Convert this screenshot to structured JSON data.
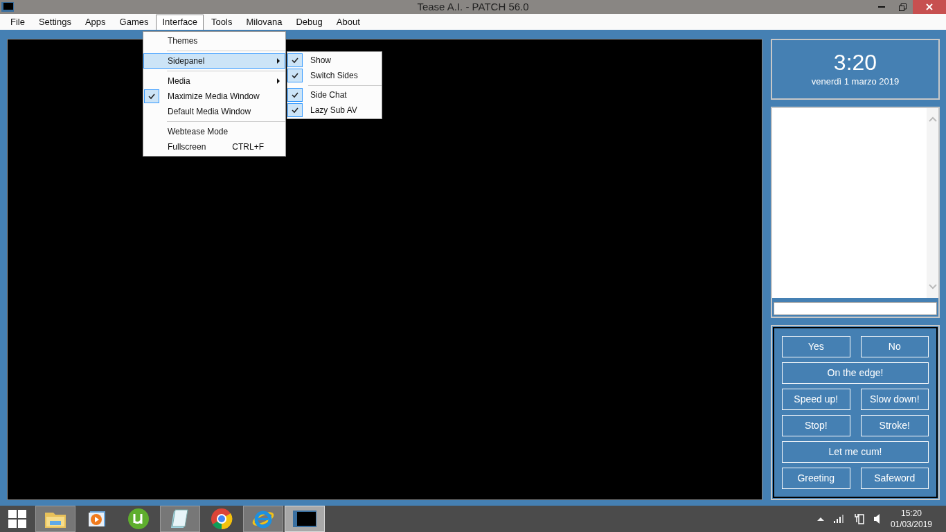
{
  "window": {
    "title": "Tease A.I. - PATCH 56.0"
  },
  "menu_bar": [
    {
      "label": "File",
      "selected": false
    },
    {
      "label": "Settings",
      "selected": false
    },
    {
      "label": "Apps",
      "selected": false
    },
    {
      "label": "Games",
      "selected": false
    },
    {
      "label": "Interface",
      "selected": true
    },
    {
      "label": "Tools",
      "selected": false
    },
    {
      "label": "Milovana",
      "selected": false
    },
    {
      "label": "Debug",
      "selected": false
    },
    {
      "label": "About",
      "selected": false
    }
  ],
  "interface_menu": [
    {
      "kind": "item",
      "label": "Themes",
      "checked": false,
      "selected": false,
      "submenu": false
    },
    {
      "kind": "separator"
    },
    {
      "kind": "item",
      "label": "Sidepanel",
      "checked": false,
      "selected": true,
      "submenu": true
    },
    {
      "kind": "separator"
    },
    {
      "kind": "item",
      "label": "Media",
      "checked": false,
      "selected": false,
      "submenu": true
    },
    {
      "kind": "item",
      "label": "Maximize Media Window",
      "checked": true,
      "selected": false,
      "submenu": false
    },
    {
      "kind": "item",
      "label": "Default Media Window",
      "checked": false,
      "selected": false,
      "submenu": false
    },
    {
      "kind": "separator"
    },
    {
      "kind": "item",
      "label": "Webtease Mode",
      "checked": false,
      "selected": false,
      "submenu": false
    },
    {
      "kind": "item",
      "label": "Fullscreen",
      "shortcut": "CTRL+F",
      "checked": false,
      "selected": false,
      "submenu": false
    }
  ],
  "sidepanel_menu": [
    {
      "kind": "item",
      "label": "Show",
      "checked": true
    },
    {
      "kind": "item",
      "label": "Switch Sides",
      "checked": true
    },
    {
      "kind": "separator"
    },
    {
      "kind": "item",
      "label": "Side Chat",
      "checked": true
    },
    {
      "kind": "item",
      "label": "Lazy Sub AV",
      "checked": true
    }
  ],
  "clock": {
    "time": "3:20",
    "date": "venerdì 1 marzo 2019"
  },
  "buttons": [
    {
      "label": "Yes",
      "kind": "half"
    },
    {
      "label": "No",
      "kind": "half"
    },
    {
      "label": "On the edge!",
      "kind": "full"
    },
    {
      "label": "Speed up!",
      "kind": "half"
    },
    {
      "label": "Slow down!",
      "kind": "half"
    },
    {
      "label": "Stop!",
      "kind": "half"
    },
    {
      "label": "Stroke!",
      "kind": "half"
    },
    {
      "label": "Let me cum!",
      "kind": "full"
    },
    {
      "label": "Greeting",
      "kind": "half"
    },
    {
      "label": "Safeword",
      "kind": "half"
    }
  ],
  "taskbar": {
    "apps": [
      {
        "kind": "explorer",
        "selected": false,
        "open": true
      },
      {
        "kind": "media",
        "selected": false,
        "open": false
      },
      {
        "kind": "torrent",
        "selected": false,
        "open": false
      },
      {
        "kind": "notepad",
        "selected": false,
        "open": true
      },
      {
        "kind": "chrome",
        "selected": false,
        "open": false
      },
      {
        "kind": "ie",
        "selected": false,
        "open": true
      },
      {
        "kind": "app",
        "selected": true,
        "open": true
      }
    ],
    "time": "15:20",
    "date": "01/03/2019"
  }
}
